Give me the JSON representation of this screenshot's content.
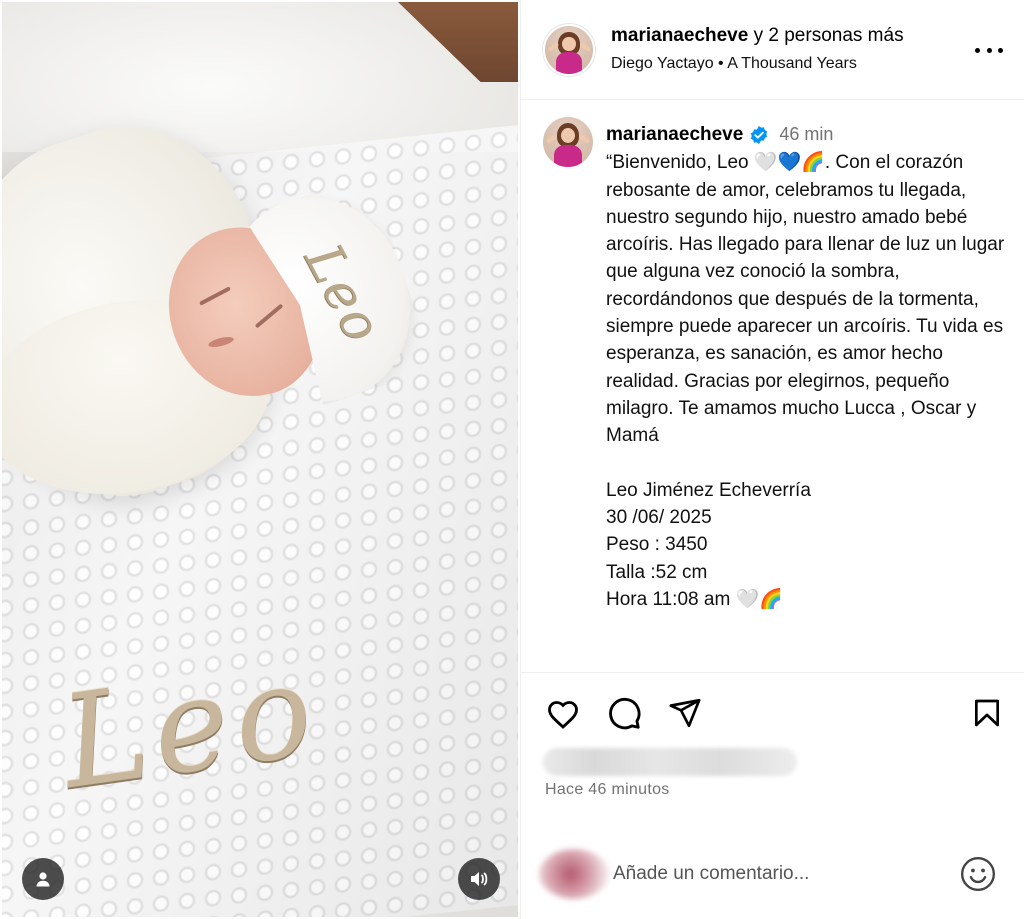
{
  "post": {
    "header": {
      "username": "marianaecheve",
      "coauthors": "y 2 personas más",
      "artist": "Diego Yactayo",
      "separator": "•",
      "song": "A Thousand Years"
    },
    "caption": {
      "username": "marianaecheve",
      "verified": true,
      "time": "46 min",
      "text": "“Bienvenido, Leo 🤍💙🌈. Con el corazón rebosante de amor, celebramos tu llegada, nuestro segundo hijo, nuestro amado bebé arcoíris. Has llegado para llenar de luz un lugar que alguna vez conoció la sombra, recordándonos que después de la tormenta, siempre puede aparecer un arcoíris. Tu vida es esperanza, es sanación, es amor hecho realidad. Gracias por elegirnos, pequeño milagro. Te amamos mucho Lucca , Oscar y Mamá\n\nLeo Jiménez Echeverría\n30 /06/ 2025\nPeso : 3450\nTalla :52 cm\nHora 11:08 am 🤍🌈"
    },
    "media": {
      "hat_name": "Leo",
      "blanket_name": "Leo"
    },
    "footer": {
      "time_ago": "Hace 46 minutos",
      "comment_placeholder": "Añade un comentario..."
    },
    "icons": {
      "like": "heart-icon",
      "comment": "comment-icon",
      "share": "share-icon",
      "save": "bookmark-icon",
      "emoji": "emoji-icon",
      "more": "more-options-icon",
      "tags": "user-tag-icon",
      "audio": "audio-icon",
      "verified": "verified-badge-icon"
    },
    "colors": {
      "verified": "#0095F6",
      "secondary_text": "#737373"
    }
  }
}
